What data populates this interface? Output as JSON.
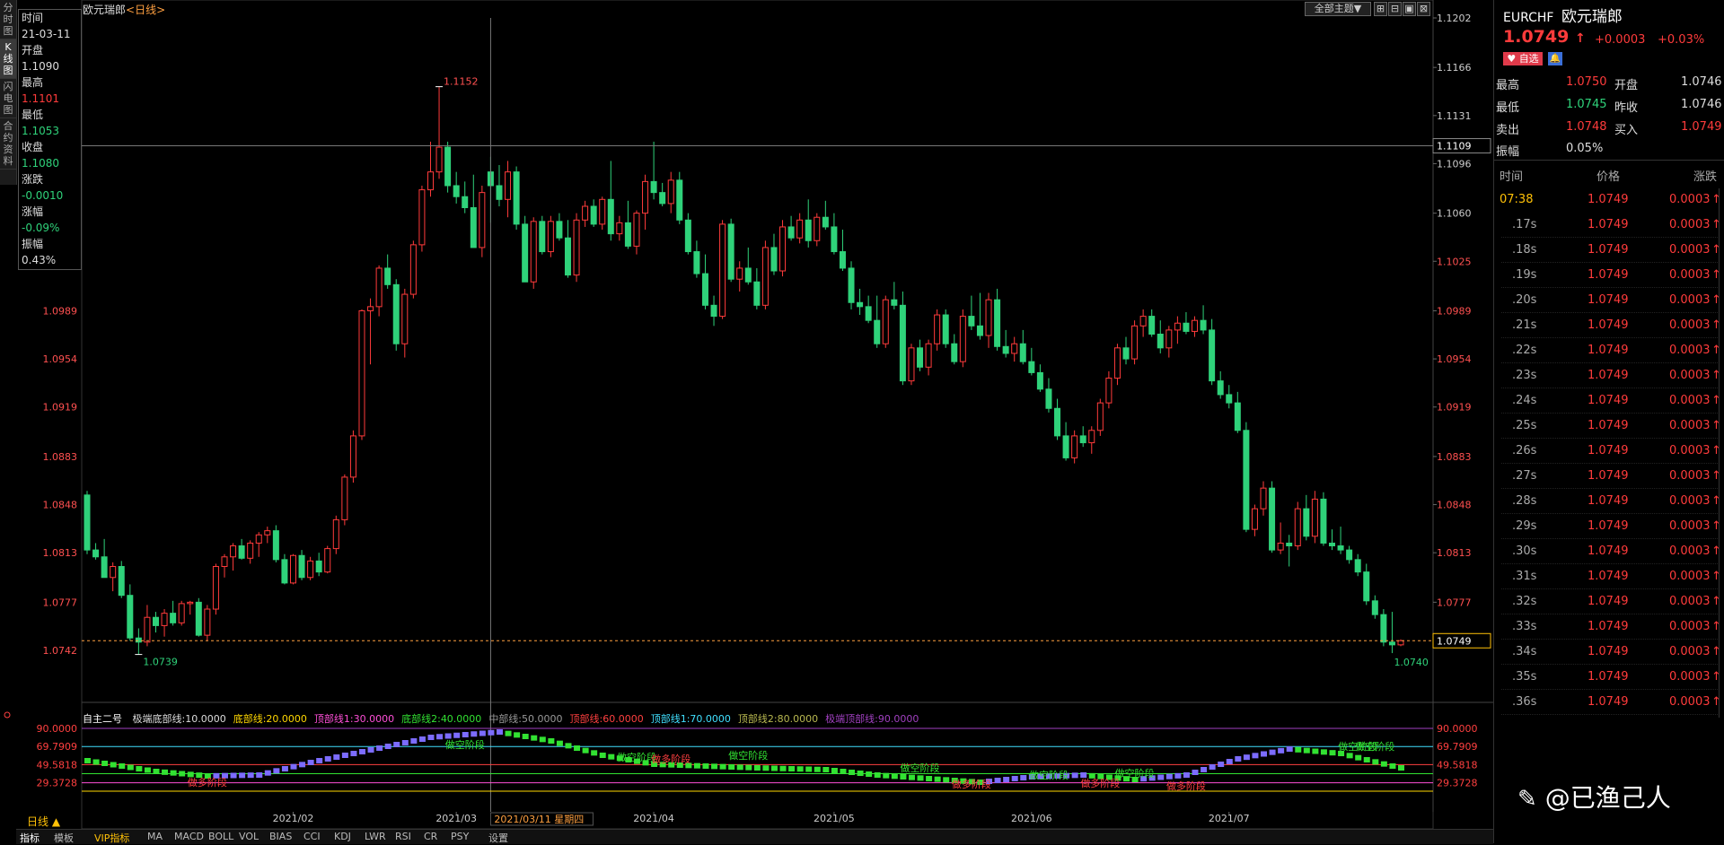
{
  "left_tabs": [
    "分时图",
    "K线图",
    "闪电图",
    "合约资料"
  ],
  "active_tab_index": 1,
  "chart_title": "欧元瑞郎",
  "chart_period": "<日线>",
  "toolbar": {
    "theme_label": "全部主题▼"
  },
  "info_box": {
    "time_label": "时间",
    "time": "21-03-11",
    "open_label": "开盘",
    "open": "1.1090",
    "high_label": "最高",
    "high": "1.1101",
    "low_label": "最低",
    "low": "1.1053",
    "close_label": "收盘",
    "close": "1.1080",
    "change_label": "涨跌",
    "change": "-0.0010",
    "pct_label": "涨幅",
    "pct": "-0.09%",
    "amp_label": "振幅",
    "amp": "0.43%"
  },
  "price_axis": {
    "right_labels": [
      "1.1202",
      "1.1166",
      "1.1131",
      "1.1096",
      "1.1060",
      "1.1025",
      "1.0989",
      "1.0954",
      "1.0919",
      "1.0883",
      "1.0848",
      "1.0813",
      "1.0777"
    ],
    "left_labels": [
      "1.0989",
      "1.0954",
      "1.0919",
      "1.0883",
      "1.0848",
      "1.0813",
      "1.0777",
      "1.0742"
    ],
    "crosshair_price": "1.1109",
    "current_price": "1.0749",
    "max_marker": "1.1152",
    "min_marker": "1.0739",
    "last_low_marker": "1.0740"
  },
  "indicator": {
    "name": "自主二号",
    "params": [
      {
        "text": "极端底部线:10.0000",
        "color": "#dddddd"
      },
      {
        "text": "底部线:20.0000",
        "color": "#ffd700"
      },
      {
        "text": "顶部线1:30.0000",
        "color": "#ff4fd8"
      },
      {
        "text": "底部线2:40.0000",
        "color": "#32e232"
      },
      {
        "text": "中部线:50.0000",
        "color": "#999999"
      },
      {
        "text": "顶部线:60.0000",
        "color": "#ff4040"
      },
      {
        "text": "顶部线1:70.0000",
        "color": "#40e0ff"
      },
      {
        "text": "顶部线2:80.0000",
        "color": "#b8b850"
      },
      {
        "text": "极端顶部线:90.0000",
        "color": "#a040c0"
      }
    ],
    "levels": [
      "90.0000",
      "69.7909",
      "49.5818",
      "29.3728"
    ],
    "annotations": [
      "做空阶段",
      "做空阶段",
      "做空阶段",
      "做空阶段",
      "做空阶段",
      "做空阶段",
      "做空阶段",
      "做空阶段",
      "做多阶段",
      "做多阶段",
      "做多阶段",
      "做多阶段",
      "做多阶段"
    ]
  },
  "date_axis": {
    "labels": [
      "2021/02",
      "2021/03",
      "2021/04",
      "2021/05",
      "2021/06",
      "2021/07"
    ],
    "crosshair_date": "2021/03/11 星期四"
  },
  "period_button": "日线 ▲",
  "bottom_tabs": [
    "指标",
    "模板",
    "VIP指标",
    "MA",
    "MACD",
    "BOLL",
    "VOL",
    "BIAS",
    "CCI",
    "KDJ",
    "LWR",
    "RSI",
    "CR",
    "PSY",
    "设置"
  ],
  "quote": {
    "symbol": "EURCHF",
    "name": "欧元瑞郎",
    "price": "1.0749",
    "arrow": "↑",
    "change": "+0.0003",
    "pct": "+0.03%",
    "fav_label": "自选",
    "high_label": "最高",
    "high": "1.0750",
    "open_label": "开盘",
    "open": "1.0746",
    "low_label": "最低",
    "low": "1.0745",
    "prev_label": "昨收",
    "prev": "1.0746",
    "sell_label": "卖出",
    "sell": "1.0748",
    "buy_label": "买入",
    "buy": "1.0749",
    "amp_label": "振幅",
    "amp": "0.05%"
  },
  "ticks_header": {
    "time": "时间",
    "price": "价格",
    "change": "涨跌"
  },
  "ticks": [
    {
      "time": "07:38",
      "price": "1.0749",
      "change": "0.0003"
    },
    {
      "time": ".17s",
      "price": "1.0749",
      "change": "0.0003"
    },
    {
      "time": ".18s",
      "price": "1.0749",
      "change": "0.0003"
    },
    {
      "time": ".19s",
      "price": "1.0749",
      "change": "0.0003"
    },
    {
      "time": ".20s",
      "price": "1.0749",
      "change": "0.0003"
    },
    {
      "time": ".21s",
      "price": "1.0749",
      "change": "0.0003"
    },
    {
      "time": ".22s",
      "price": "1.0749",
      "change": "0.0003"
    },
    {
      "time": ".23s",
      "price": "1.0749",
      "change": "0.0003"
    },
    {
      "time": ".24s",
      "price": "1.0749",
      "change": "0.0003"
    },
    {
      "time": ".25s",
      "price": "1.0749",
      "change": "0.0003"
    },
    {
      "time": ".26s",
      "price": "1.0749",
      "change": "0.0003"
    },
    {
      "time": ".27s",
      "price": "1.0749",
      "change": "0.0003"
    },
    {
      "time": ".28s",
      "price": "1.0749",
      "change": "0.0003"
    },
    {
      "time": ".29s",
      "price": "1.0749",
      "change": "0.0003"
    },
    {
      "time": ".30s",
      "price": "1.0749",
      "change": "0.0003"
    },
    {
      "time": ".31s",
      "price": "1.0749",
      "change": "0.0003"
    },
    {
      "time": ".32s",
      "price": "1.0749",
      "change": "0.0003"
    },
    {
      "time": ".33s",
      "price": "1.0749",
      "change": "0.0003"
    },
    {
      "time": ".34s",
      "price": "1.0749",
      "change": "0.0003"
    },
    {
      "time": ".35s",
      "price": "1.0749",
      "change": "0.0003"
    },
    {
      "time": ".36s",
      "price": "1.0749",
      "change": "0.0003"
    }
  ],
  "watermark": "@已渔己人",
  "colors": {
    "up": "#ff3b3b",
    "down": "#2fd27a",
    "accent": "#ffc107",
    "bg": "#000000"
  }
}
